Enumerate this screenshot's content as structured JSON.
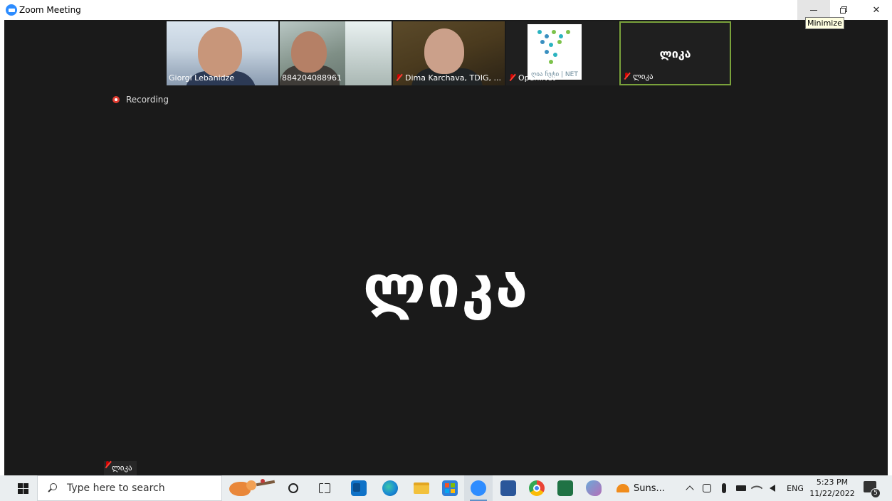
{
  "window": {
    "title": "Zoom Meeting",
    "tooltip": "Minimize",
    "minimize_icon": "minimize-icon",
    "maximize_icon": "restore-icon",
    "close_glyph": "✕"
  },
  "meeting": {
    "recording_label": "Recording",
    "active_speaker": "ლიკა",
    "self_view_label": "ლიკა",
    "participants": [
      {
        "name": "Giorgi Lebanidze",
        "muted": false,
        "video": true
      },
      {
        "name": "884204088961",
        "muted": false,
        "video": true
      },
      {
        "name": "Dima Karchava, TDIG, ...",
        "muted": true,
        "video": true
      },
      {
        "name": "Open.Net",
        "muted": true,
        "video": true,
        "logo_text": "ღია ნეტი | NET"
      },
      {
        "name": "ლიკა",
        "muted": true,
        "video": false,
        "display_name": "ლიკა",
        "active": true
      }
    ]
  },
  "taskbar": {
    "search_placeholder": "Type here to search",
    "apps": [
      "cortana-icon",
      "task-view-icon",
      "outlook-icon",
      "edge-icon",
      "file-explorer-icon",
      "microsoft-store-icon",
      "zoom-icon",
      "word-icon",
      "chrome-icon",
      "excel-icon",
      "paint-icon"
    ],
    "sunset_app_label": "Suns...",
    "language": "ENG",
    "time": "5:23 PM",
    "date": "11/22/2022",
    "notification_count": "5"
  },
  "colors": {
    "meeting_bg": "#1a1a1a",
    "active_border": "#7aa23b",
    "zoom_blue": "#2d8cff",
    "recording_red": "#e03c31",
    "taskbar_bg": "#eaeef0"
  }
}
